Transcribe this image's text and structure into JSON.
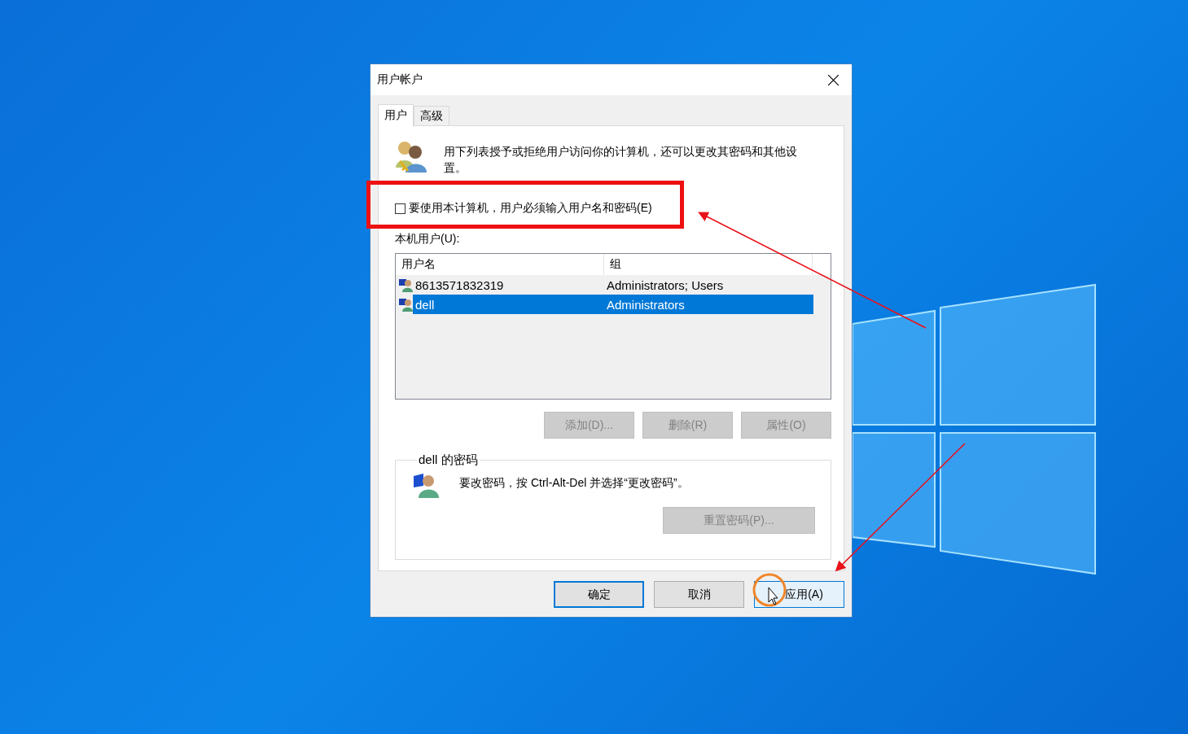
{
  "window": {
    "title": "用户帐户"
  },
  "tabs": [
    {
      "label": "用户",
      "selected": true
    },
    {
      "label": "高级",
      "selected": false
    }
  ],
  "intro": "用下列表授予或拒绝用户访问你的计算机，还可以更改其密码和其他设置。",
  "require_password": {
    "label": "要使用本计算机，用户必须输入用户名和密码(E)",
    "checked": false
  },
  "users_label": "本机用户(U):",
  "table": {
    "columns": [
      "用户名",
      "组"
    ],
    "rows": [
      {
        "name": "8613571832319",
        "group": "Administrators; Users",
        "selected": false
      },
      {
        "name": "dell",
        "group": "Administrators",
        "selected": true
      }
    ]
  },
  "user_buttons": [
    {
      "label": "添加(D)...",
      "disabled": true
    },
    {
      "label": "删除(R)",
      "disabled": true
    },
    {
      "label": "属性(O)",
      "disabled": true
    }
  ],
  "password_group": {
    "title": "dell 的密码",
    "text": "要改密码，按 Ctrl-Alt-Del 并选择“更改密码”。",
    "button": {
      "label": "重置密码(P)...",
      "disabled": true
    }
  },
  "dialog_buttons": [
    {
      "label": "确定",
      "kind": "default"
    },
    {
      "label": "取消",
      "kind": "normal"
    },
    {
      "label": "应用(A)",
      "kind": "hover"
    }
  ]
}
